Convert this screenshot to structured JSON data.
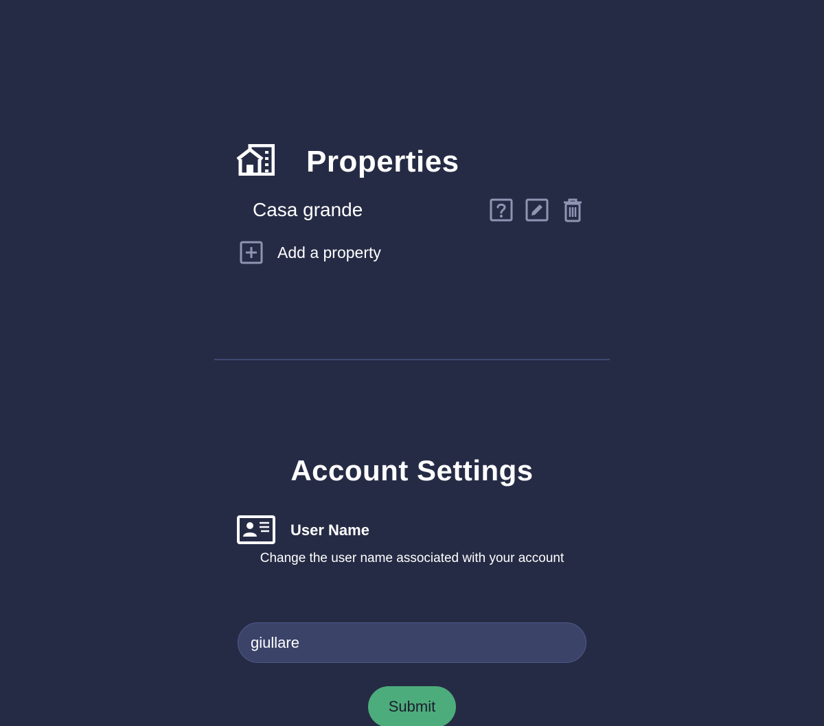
{
  "properties": {
    "title": "Properties",
    "icon": "building-house-icon",
    "items": [
      {
        "name": "Casa grande"
      }
    ],
    "item_actions": [
      "help-icon",
      "edit-icon",
      "delete-icon"
    ],
    "add_label": "Add a property"
  },
  "account_settings": {
    "title": "Account Settings",
    "user_name": {
      "icon": "id-card-icon",
      "label": "User Name",
      "description": "Change the user name associated with your account",
      "value": "giullare",
      "placeholder": ""
    },
    "submit_label": "Submit"
  },
  "colors": {
    "background": "#262b45",
    "text": "#ffffff",
    "icon_muted": "#8e96b3",
    "input_bg": "#3b4369",
    "divider": "#3e4873",
    "submit_bg": "#4dac7c"
  }
}
